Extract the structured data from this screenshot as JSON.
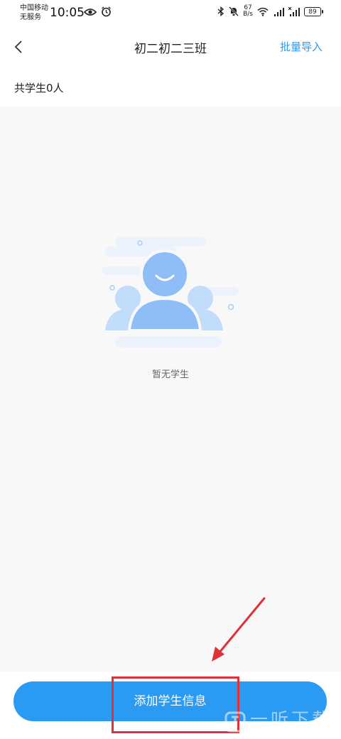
{
  "status_bar": {
    "carrier_line1": "中国移动",
    "carrier_line2": "无服务",
    "time": "10:05",
    "net_speed_value": "67",
    "net_speed_unit": "B/s",
    "battery": "89"
  },
  "nav": {
    "title": "初二初二三班",
    "action": "批量导入"
  },
  "student_count": "共学生0人",
  "empty_state": {
    "text": "暂无学生"
  },
  "bottom": {
    "add_label": "添加学生信息"
  },
  "watermark": "一听下载",
  "colors": {
    "accent": "#2b9af3",
    "highlight": "#e0303a",
    "illustration_main": "#8fbdf8",
    "illustration_light": "#c2dcfb"
  }
}
